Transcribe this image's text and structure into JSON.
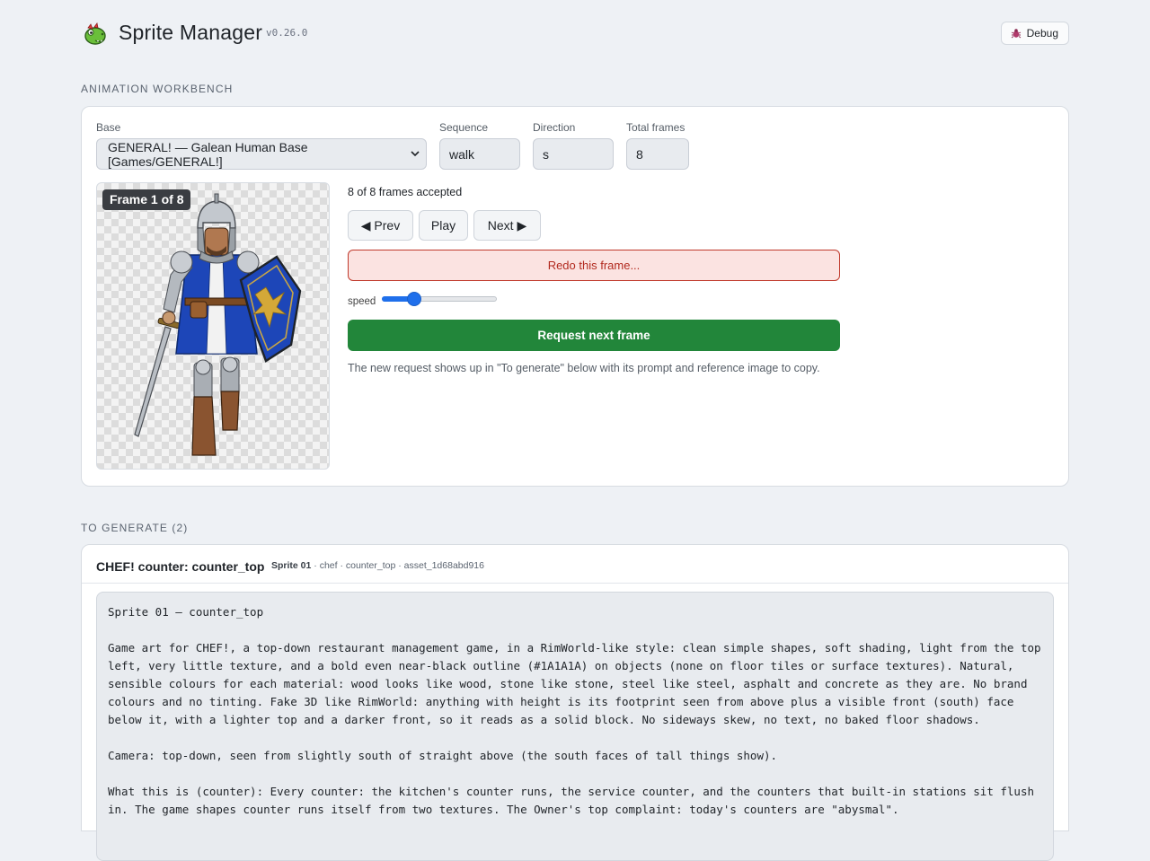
{
  "header": {
    "title": "Sprite Manager",
    "version": "v0.26.0",
    "debug_label": "Debug"
  },
  "workbench": {
    "section_label": "ANIMATION WORKBENCH",
    "base_label": "Base",
    "base_value": "GENERAL! — Galean Human Base [Games/GENERAL!]",
    "sequence_label": "Sequence",
    "sequence_value": "walk",
    "direction_label": "Direction",
    "direction_value": "s",
    "total_frames_label": "Total frames",
    "total_frames_value": "8",
    "frame_badge": "Frame 1 of 8",
    "accepted_text": "8 of 8 frames accepted",
    "prev_label": "◀ Prev",
    "play_label": "Play",
    "next_label": "Next ▶",
    "redo_label": "Redo this frame...",
    "speed_label": "speed",
    "speed_fraction": 0.25,
    "request_label": "Request next frame",
    "hint_text": "The new request shows up in \"To generate\" below with its prompt and reference image to copy."
  },
  "to_generate": {
    "section_label": "TO GENERATE (2)",
    "item_title": "CHEF! counter: counter_top",
    "item_meta_bold": "Sprite 01",
    "item_meta_rest": " · chef · counter_top · asset_1d68abd916",
    "prompt_text": "Sprite 01 — counter_top\n\nGame art for CHEF!, a top-down restaurant management game, in a RimWorld-like style: clean simple shapes, soft shading, light from the top left, very little texture, and a bold even near-black outline (#1A1A1A) on objects (none on floor tiles or surface textures). Natural, sensible colours for each material: wood looks like wood, stone like stone, steel like steel, asphalt and concrete as they are. No brand colours and no tinting. Fake 3D like RimWorld: anything with height is its footprint seen from above plus a visible front (south) face below it, with a lighter top and a darker front, so it reads as a solid block. No sideways skew, no text, no baked floor shadows.\n\nCamera: top-down, seen from slightly south of straight above (the south faces of tall things show).\n\nWhat this is (counter): Every counter: the kitchen's counter runs, the service counter, and the counters that built-in stations sit flush in. The game shapes counter runs itself from two textures. The Owner's top complaint: today's counters are \"abysmal\"."
  },
  "colors": {
    "accent_green": "#22863a",
    "redo_red": "#b22a1f",
    "slider_blue": "#1f6feb"
  },
  "icons": {
    "logo": "dragon-logo-icon",
    "debug": "bug-icon",
    "select": "chevron-down-icon"
  }
}
